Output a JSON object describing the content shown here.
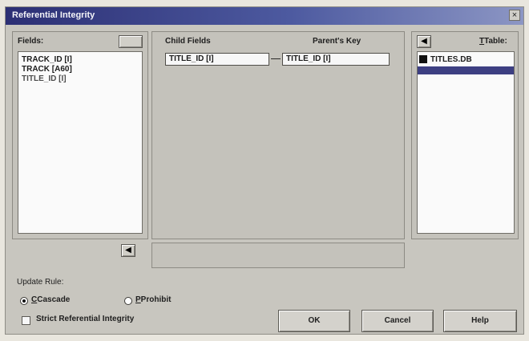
{
  "window": {
    "title": "Referential Integrity"
  },
  "fields": {
    "label": "Fields:",
    "items": [
      "TRACK_ID [I]",
      "TRACK [A60]",
      "TITLE_ID [I]"
    ]
  },
  "mapping": {
    "child_label": "Child Fields",
    "parent_label": "Parent's Key",
    "child_value": "TITLE_ID [I]",
    "parent_value": "TITLE_ID [I]"
  },
  "table": {
    "label": "Table:",
    "items": [
      "TITLES.DB"
    ]
  },
  "update_rule": {
    "label": "Update Rule:",
    "options": [
      {
        "label": "Cascade",
        "selected": true
      },
      {
        "label": "Prohibit",
        "selected": false
      }
    ]
  },
  "strict": {
    "label": "Strict Referential Integrity",
    "checked": false
  },
  "buttons": {
    "ok": "OK",
    "cancel": "Cancel",
    "help": "Help"
  },
  "icons": {
    "close": "close-icon",
    "arrow_left": "arrow-left-icon",
    "table": "table-icon"
  }
}
